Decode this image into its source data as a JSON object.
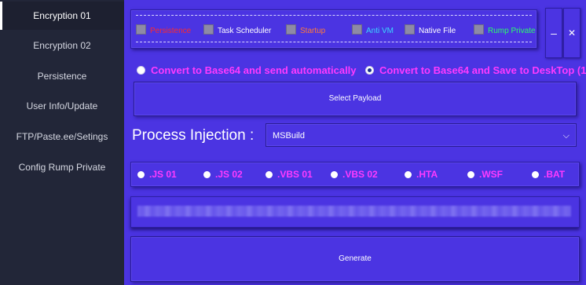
{
  "sidebar": {
    "items": [
      {
        "label": "Encryption 01",
        "active": true
      },
      {
        "label": "Encryption 02",
        "active": false
      },
      {
        "label": "Persistence",
        "active": false
      },
      {
        "label": "User Info/Update",
        "active": false
      },
      {
        "label": "FTP/Paste.ee/Setings",
        "active": false
      },
      {
        "label": "Config Rump Private",
        "active": false
      }
    ]
  },
  "options": {
    "checkboxes": [
      {
        "label": "Persistence",
        "color": "#ff2a2a"
      },
      {
        "label": "Task Scheduler",
        "color": "#ffffff"
      },
      {
        "label": "Startup",
        "color": "#ff7a3a"
      },
      {
        "label": "Anti VM",
        "color": "#3ad6ff"
      },
      {
        "label": "Native File",
        "color": "#ffffff"
      },
      {
        "label": "Rump Private",
        "color": "#2aff6a"
      }
    ]
  },
  "window": {
    "minimize_glyph": "–",
    "close_glyph": "✕"
  },
  "delivery": {
    "radio_auto": "Convert to Base64 and send automatically",
    "radio_save": "Convert to Base64 and Save to DeskTop (1",
    "selected": "save"
  },
  "payload": {
    "select_label": "Select Payload"
  },
  "injection": {
    "label": "Process Injection :",
    "selected": "MSBuild"
  },
  "extensions": [
    ".JS 01",
    ".JS 02",
    ".VBS 01",
    ".VBS 02",
    ".HTA",
    ".WSF",
    ".BAT"
  ],
  "actions": {
    "generate_label": "Generate"
  },
  "colors": {
    "main_bg": "#4b34e2",
    "sidebar_bg": "#222638",
    "accent_magenta": "#ff3aff"
  }
}
